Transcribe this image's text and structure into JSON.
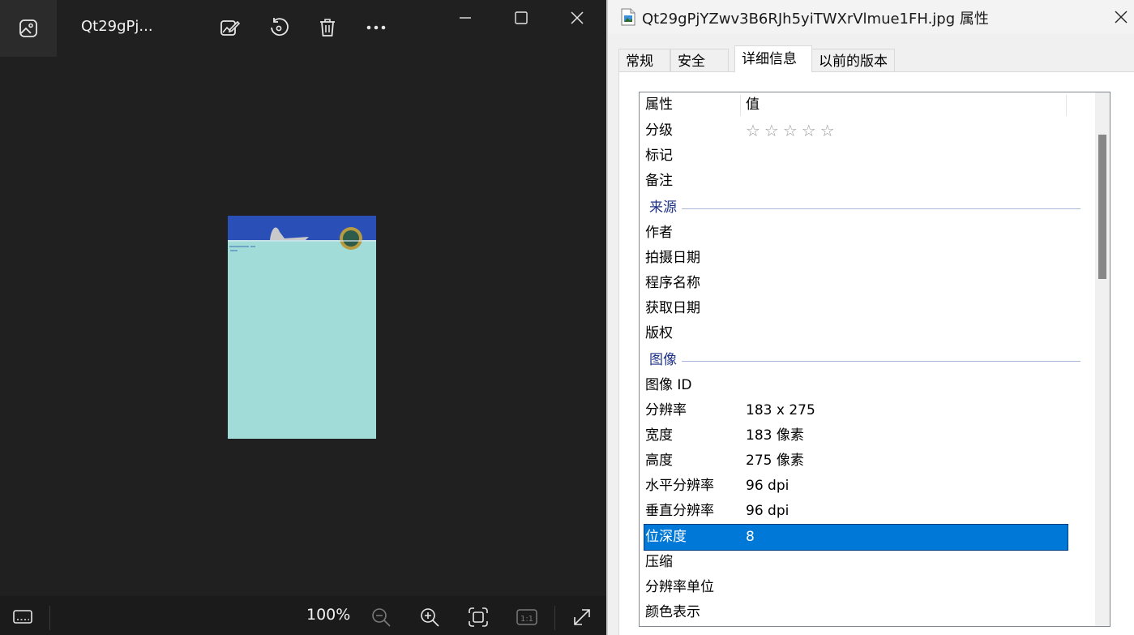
{
  "viewer": {
    "filename": "Qt29gPj...",
    "zoom": "100%",
    "actual_size_label": "1:1",
    "toolbar_icons": [
      "gallery-icon",
      "edit-image-icon",
      "rotate-icon",
      "delete-icon",
      "more-icon"
    ],
    "window_icons": [
      "minimize-icon",
      "maximize-icon",
      "close-icon"
    ],
    "bottom_icons": [
      "filmstrip-icon",
      "zoom-out-icon",
      "zoom-in-icon",
      "fit-to-window-icon",
      "actual-size-icon",
      "fullscreen-icon"
    ]
  },
  "dialog": {
    "title": "Qt29gPjYZwv3B6RJh5yiTWXrVlmue1FH.jpg 属性",
    "tabs": [
      "常规",
      "安全",
      "详细信息",
      "以前的版本"
    ],
    "active_tab": "详细信息",
    "header": {
      "name": "属性",
      "value": "值"
    },
    "rows_top": [
      {
        "name": "分级",
        "value": "☆☆☆☆☆"
      },
      {
        "name": "标记",
        "value": ""
      },
      {
        "name": "备注",
        "value": ""
      }
    ],
    "group_source": "来源",
    "rows_source": [
      {
        "name": "作者",
        "value": ""
      },
      {
        "name": "拍摄日期",
        "value": ""
      },
      {
        "name": "程序名称",
        "value": ""
      },
      {
        "name": "获取日期",
        "value": ""
      },
      {
        "name": "版权",
        "value": ""
      }
    ],
    "group_image": "图像",
    "rows_image": [
      {
        "name": "图像 ID",
        "value": ""
      },
      {
        "name": "分辨率",
        "value": "183 x 275"
      },
      {
        "name": "宽度",
        "value": "183 像素"
      },
      {
        "name": "高度",
        "value": "275 像素"
      },
      {
        "name": "水平分辨率",
        "value": "96 dpi"
      },
      {
        "name": "垂直分辨率",
        "value": "96 dpi"
      },
      {
        "name": "位深度",
        "value": "8",
        "selected": true
      },
      {
        "name": "压缩",
        "value": ""
      },
      {
        "name": "分辨率单位",
        "value": ""
      },
      {
        "name": "颜色表示",
        "value": ""
      }
    ],
    "selection_color": "#0078d7"
  }
}
